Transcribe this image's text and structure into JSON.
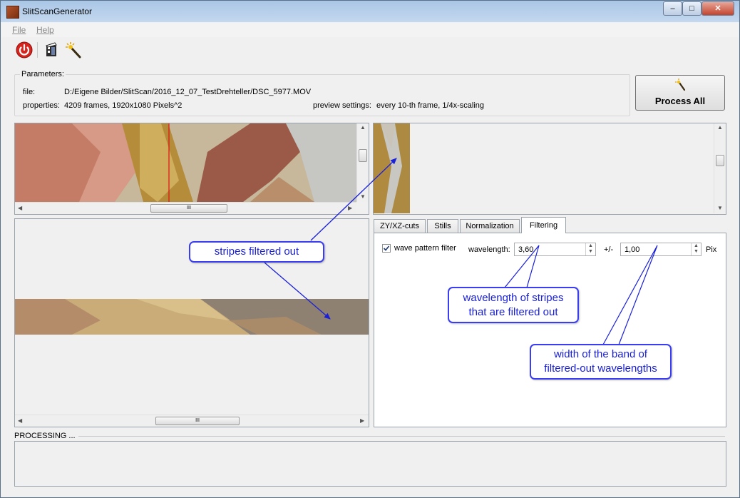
{
  "window": {
    "title": "SlitScanGenerator"
  },
  "menu": {
    "file": "File",
    "help": "Help"
  },
  "toolbar": {
    "icons": [
      "power-icon",
      "film-clip-icon",
      "magic-wand-icon"
    ]
  },
  "parameters": {
    "group_label": "Parameters:",
    "file_label": "file:",
    "file_value": "D:/Eigene Bilder/SlitScan/2016_12_07_TestDrehteller/DSC_5977.MOV",
    "properties_label": "properties:",
    "properties_value": "4209 frames, 1920x1080 Pixels^2",
    "preview_label": "preview settings:",
    "preview_value": "every 10-th frame, 1/4x-scaling"
  },
  "process_button": {
    "label": "Process All"
  },
  "scroll_grip": "III",
  "tabs": [
    {
      "label": "ZY/XZ-cuts",
      "active": false
    },
    {
      "label": "Stills",
      "active": false
    },
    {
      "label": "Normalization",
      "active": false
    },
    {
      "label": "Filtering",
      "active": true
    }
  ],
  "filtering": {
    "checkbox_label": "wave pattern filter",
    "checked": true,
    "wavelength_label": "wavelength:",
    "wavelength_value": "3,60",
    "plusminus_label": "+/-",
    "band_value": "1,00",
    "unit": "Pix"
  },
  "callouts": {
    "stripes": "stripes filtered out",
    "wavelength_line1": "wavelength of stripes",
    "wavelength_line2": "that are filtered out",
    "band_line1": "width of the band of",
    "band_line2": "filtered-out wavelengths"
  },
  "processing": {
    "label": "PROCESSING ..."
  },
  "colors": {
    "annotation": "#1a20d8",
    "titlebar": "#b9d1ea"
  }
}
